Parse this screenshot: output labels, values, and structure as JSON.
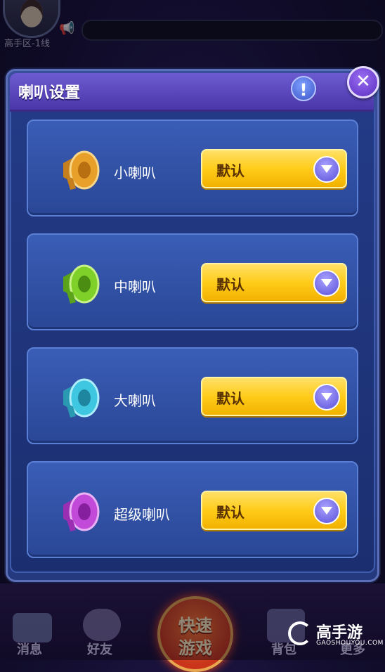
{
  "header": {
    "server_label": "高手区-1线"
  },
  "dialog": {
    "title": "喇叭设置",
    "info_label": "!",
    "close_label": "✕",
    "horns": [
      {
        "label": "小喇叭",
        "value": "默认",
        "color": "#e8a02a"
      },
      {
        "label": "中喇叭",
        "value": "默认",
        "color": "#7fd12a"
      },
      {
        "label": "大喇叭",
        "value": "默认",
        "color": "#3fc6e0"
      },
      {
        "label": "超级喇叭",
        "value": "默认",
        "color": "#c14bd8"
      }
    ]
  },
  "bottom_nav": {
    "messages": "消息",
    "friends": "好友",
    "quick_game_line1": "快速",
    "quick_game_line2": "游戏",
    "backpack": "背包",
    "more": "更多"
  },
  "watermark": {
    "title": "高手游",
    "url": "GAOSHOUYOU.COM"
  }
}
